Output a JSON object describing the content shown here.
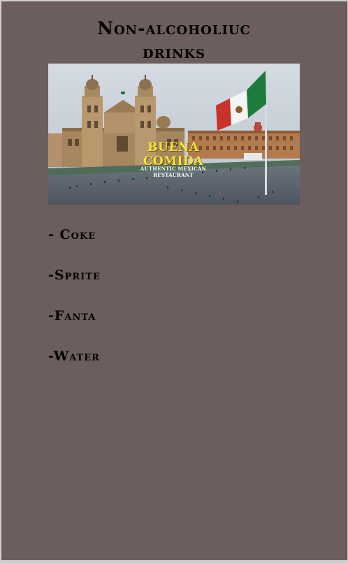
{
  "header": {
    "title_line1": "Non-alcoholiuc",
    "title_line2": "drinks"
  },
  "hero": {
    "restaurant_name": "BUENA COMIDA",
    "tagline": "AUTHENTIC MEXICAN RESTAURANT",
    "colors": {
      "sky": "#c9d3dc",
      "flag_green": "#1f7a3d",
      "flag_white": "#f4f4f4",
      "flag_red": "#c8322b",
      "name_yellow": "#f2e640"
    }
  },
  "menu": {
    "items": [
      {
        "label": "- Coke"
      },
      {
        "label": "-Sprite"
      },
      {
        "label": "-Fanta"
      },
      {
        "label": "-Water"
      }
    ]
  }
}
